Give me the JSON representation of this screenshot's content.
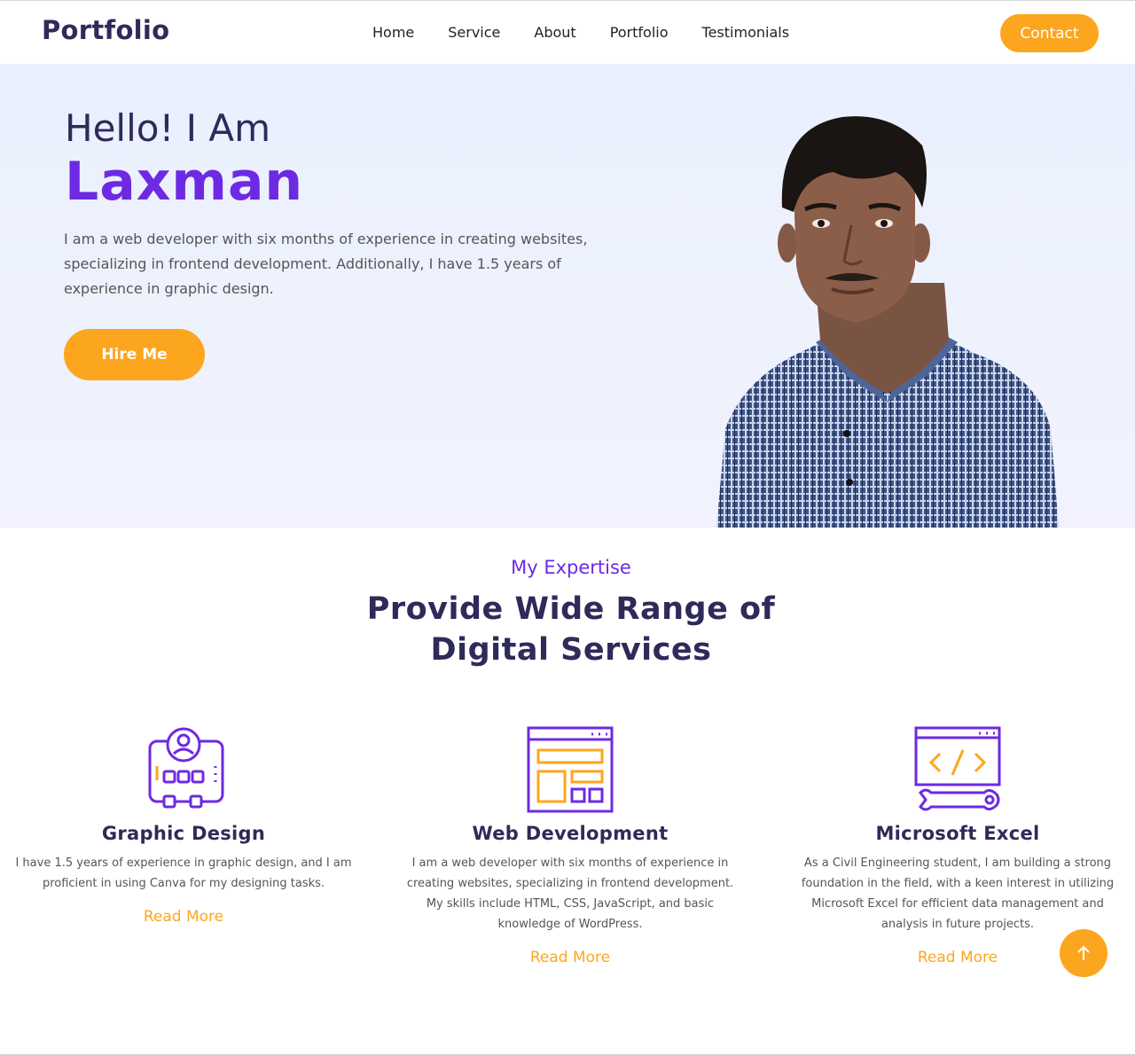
{
  "nav": {
    "logo": "Portfolio",
    "items": [
      "Home",
      "Service",
      "About",
      "Portfolio",
      "Testimonials"
    ],
    "contact_label": "Contact"
  },
  "hero": {
    "greeting": "Hello! I Am",
    "name": "Laxman",
    "intro": "I am a web developer with six months of experience in creating websites, specializing in frontend development. Additionally, I have 1.5 years of experience in graphic design.",
    "hire_label": "Hire Me"
  },
  "expertise": {
    "eyebrow": "My Expertise",
    "title_line1": "Provide Wide Range of",
    "title_line2": "Digital Services",
    "cards": [
      {
        "icon": "graphic-design-icon",
        "title": "Graphic Design",
        "description": "I have 1.5 years of experience in graphic design, and I am proficient in using Canva for my designing tasks.",
        "link": "Read More"
      },
      {
        "icon": "web-layout-icon",
        "title": "Web Development",
        "description": "I am a web developer with six months of experience in creating websites, specializing in frontend development. My skills include HTML, CSS, JavaScript, and basic knowledge of WordPress.",
        "link": "Read More"
      },
      {
        "icon": "code-wrench-icon",
        "title": "Microsoft Excel",
        "description": "As a Civil Engineering student, I am building a strong foundation in the field, with a keen interest in utilizing Microsoft Excel for efficient data management and analysis in future projects.",
        "link": "Read More"
      }
    ]
  },
  "colors": {
    "accent": "#fca61f",
    "brand_purple": "#6d2ae2",
    "heading": "#2e2a5a"
  }
}
